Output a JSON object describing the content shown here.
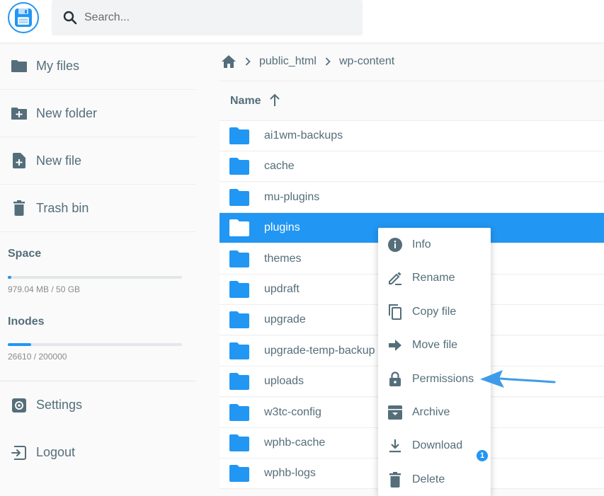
{
  "header": {
    "search_placeholder": "Search..."
  },
  "sidebar": {
    "items": [
      {
        "label": "My files",
        "icon": "folder-icon"
      },
      {
        "label": "New folder",
        "icon": "new-folder-icon"
      },
      {
        "label": "New file",
        "icon": "new-file-icon"
      },
      {
        "label": "Trash bin",
        "icon": "trash-icon"
      }
    ],
    "space": {
      "title": "Space",
      "text": "979.04 MB / 50 GB",
      "fraction": 0.02
    },
    "inodes": {
      "title": "Inodes",
      "text": "26610 / 200000",
      "fraction": 0.133
    },
    "settings_label": "Settings",
    "logout_label": "Logout"
  },
  "breadcrumb": {
    "items": [
      "public_html",
      "wp-content"
    ]
  },
  "list": {
    "header": "Name",
    "sort": "ascending",
    "selected_index": 3,
    "rows": [
      "ai1wm-backups",
      "cache",
      "mu-plugins",
      "plugins",
      "themes",
      "updraft",
      "upgrade",
      "upgrade-temp-backup",
      "uploads",
      "w3tc-config",
      "wphb-cache",
      "wphb-logs"
    ]
  },
  "context_menu": {
    "items": [
      {
        "label": "Info",
        "icon": "info-icon"
      },
      {
        "label": "Rename",
        "icon": "rename-icon"
      },
      {
        "label": "Copy file",
        "icon": "copy-icon"
      },
      {
        "label": "Move file",
        "icon": "move-icon"
      },
      {
        "label": "Permissions",
        "icon": "lock-icon"
      },
      {
        "label": "Archive",
        "icon": "archive-icon"
      },
      {
        "label": "Download",
        "icon": "download-icon"
      },
      {
        "label": "Delete",
        "icon": "delete-icon"
      }
    ]
  },
  "notification_badge": "1",
  "colors": {
    "accent": "#2196f3",
    "text": "#546e7a",
    "folder": "#2196f3"
  }
}
